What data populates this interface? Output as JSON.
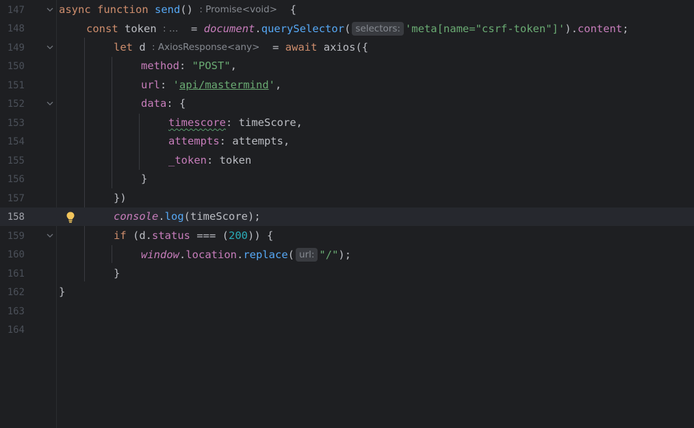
{
  "editor": {
    "lines": [
      {
        "num": "147"
      },
      {
        "num": "148"
      },
      {
        "num": "149"
      },
      {
        "num": "150"
      },
      {
        "num": "151"
      },
      {
        "num": "152"
      },
      {
        "num": "153"
      },
      {
        "num": "154"
      },
      {
        "num": "155"
      },
      {
        "num": "156"
      },
      {
        "num": "157"
      },
      {
        "num": "158"
      },
      {
        "num": "159"
      },
      {
        "num": "160"
      },
      {
        "num": "161"
      },
      {
        "num": "162"
      },
      {
        "num": "163"
      },
      {
        "num": "164"
      }
    ],
    "hints": {
      "promise_type": ": Promise<void>",
      "token_type": ": …",
      "selectors_label": "selectors:",
      "axios_type": ": AxiosResponse<any>",
      "url_label": "url:"
    },
    "code": {
      "l147": {
        "async": "async",
        "function": "function",
        "name": "send",
        "parens": "()",
        "brace": "{"
      },
      "l148": {
        "const": "const",
        "var": "token",
        "eq": "=",
        "document": "document",
        "dot": ".",
        "method": "querySelector",
        "open": "(",
        "arg": "'meta[name=\"csrf-token\"]'",
        "close": ")",
        "dot2": ".",
        "prop": "content",
        "semi": ";"
      },
      "l149": {
        "let": "let",
        "var": "d",
        "eq": "=",
        "await": "await",
        "call": "axios({"
      },
      "l150": {
        "key": "method",
        "colon": ": ",
        "value": "\"POST\"",
        "comma": ","
      },
      "l151": {
        "key": "url",
        "colon": ": ",
        "q1": "'",
        "value": "api/mastermind",
        "q2": "'",
        "comma": ","
      },
      "l152": {
        "key": "data",
        "rest": ": {"
      },
      "l153": {
        "key": "timescore",
        "rest": ": timeScore,"
      },
      "l154": {
        "key": "attempts",
        "rest": ": attempts,"
      },
      "l155": {
        "key": "_token",
        "rest": ": token"
      },
      "l156": {
        "text": "}"
      },
      "l157": {
        "text": "})"
      },
      "l158": {
        "console": "console",
        "dot": ".",
        "method": "log",
        "rest": "(timeScore);"
      },
      "l159": {
        "if": "if",
        "open": " (d.",
        "prop": "status",
        "op": " === (",
        "num": "200",
        "rest": ")) {"
      },
      "l160": {
        "window": "window",
        "dot": ".",
        "prop": "location",
        "dot2": ".",
        "method": "replace",
        "open": "(",
        "value": "\"/\"",
        "rest": ");"
      },
      "l161": {
        "text": "}"
      },
      "l162": {
        "text": "}"
      }
    },
    "colors": {
      "background": "#1e1f22",
      "keyword": "#cf8e6d",
      "function": "#56a8f5",
      "string": "#6aab73",
      "number": "#2aacb8",
      "property": "#c77dbb",
      "lightbulb": "#f2c55c"
    }
  }
}
